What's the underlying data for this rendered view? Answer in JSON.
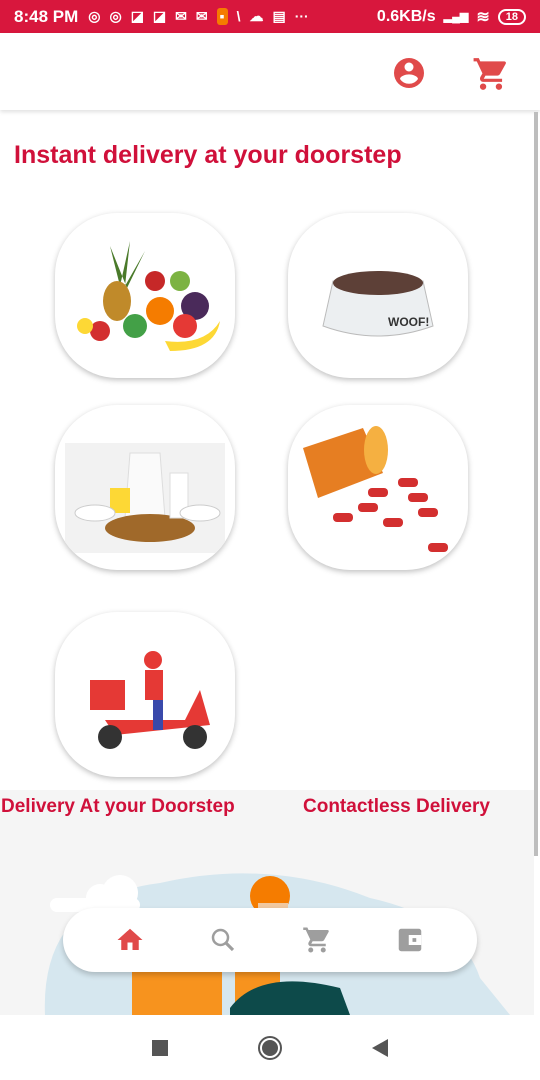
{
  "status_bar": {
    "time": "8:48 PM",
    "network_speed": "0.6KB/s",
    "battery": "18",
    "notification_icons": [
      "instagram-icon",
      "instagram-icon",
      "app-icon",
      "app-icon",
      "gmail-icon",
      "gmail-icon",
      "mi-icon",
      "slash-icon",
      "cloud-icon",
      "news-icon",
      "more-icon"
    ]
  },
  "header": {
    "icons": [
      "account-circle-icon",
      "cart-icon"
    ]
  },
  "main": {
    "title": "Instant delivery at your doorstep",
    "categories": [
      {
        "name": "fruits"
      },
      {
        "name": "pet-food"
      },
      {
        "name": "dairy"
      },
      {
        "name": "medicines"
      },
      {
        "name": "delivery-scooter"
      }
    ],
    "features": [
      "Delivery At your Doorstep",
      "Contactless Delivery"
    ]
  },
  "bottom_nav": {
    "items": [
      "home",
      "search",
      "cart",
      "wallet"
    ],
    "active": "home"
  },
  "colors": {
    "brand": "#d8173d",
    "title": "#d0103a",
    "nav_active": "#e04a4a",
    "nav_inactive": "#9e9e9e"
  }
}
